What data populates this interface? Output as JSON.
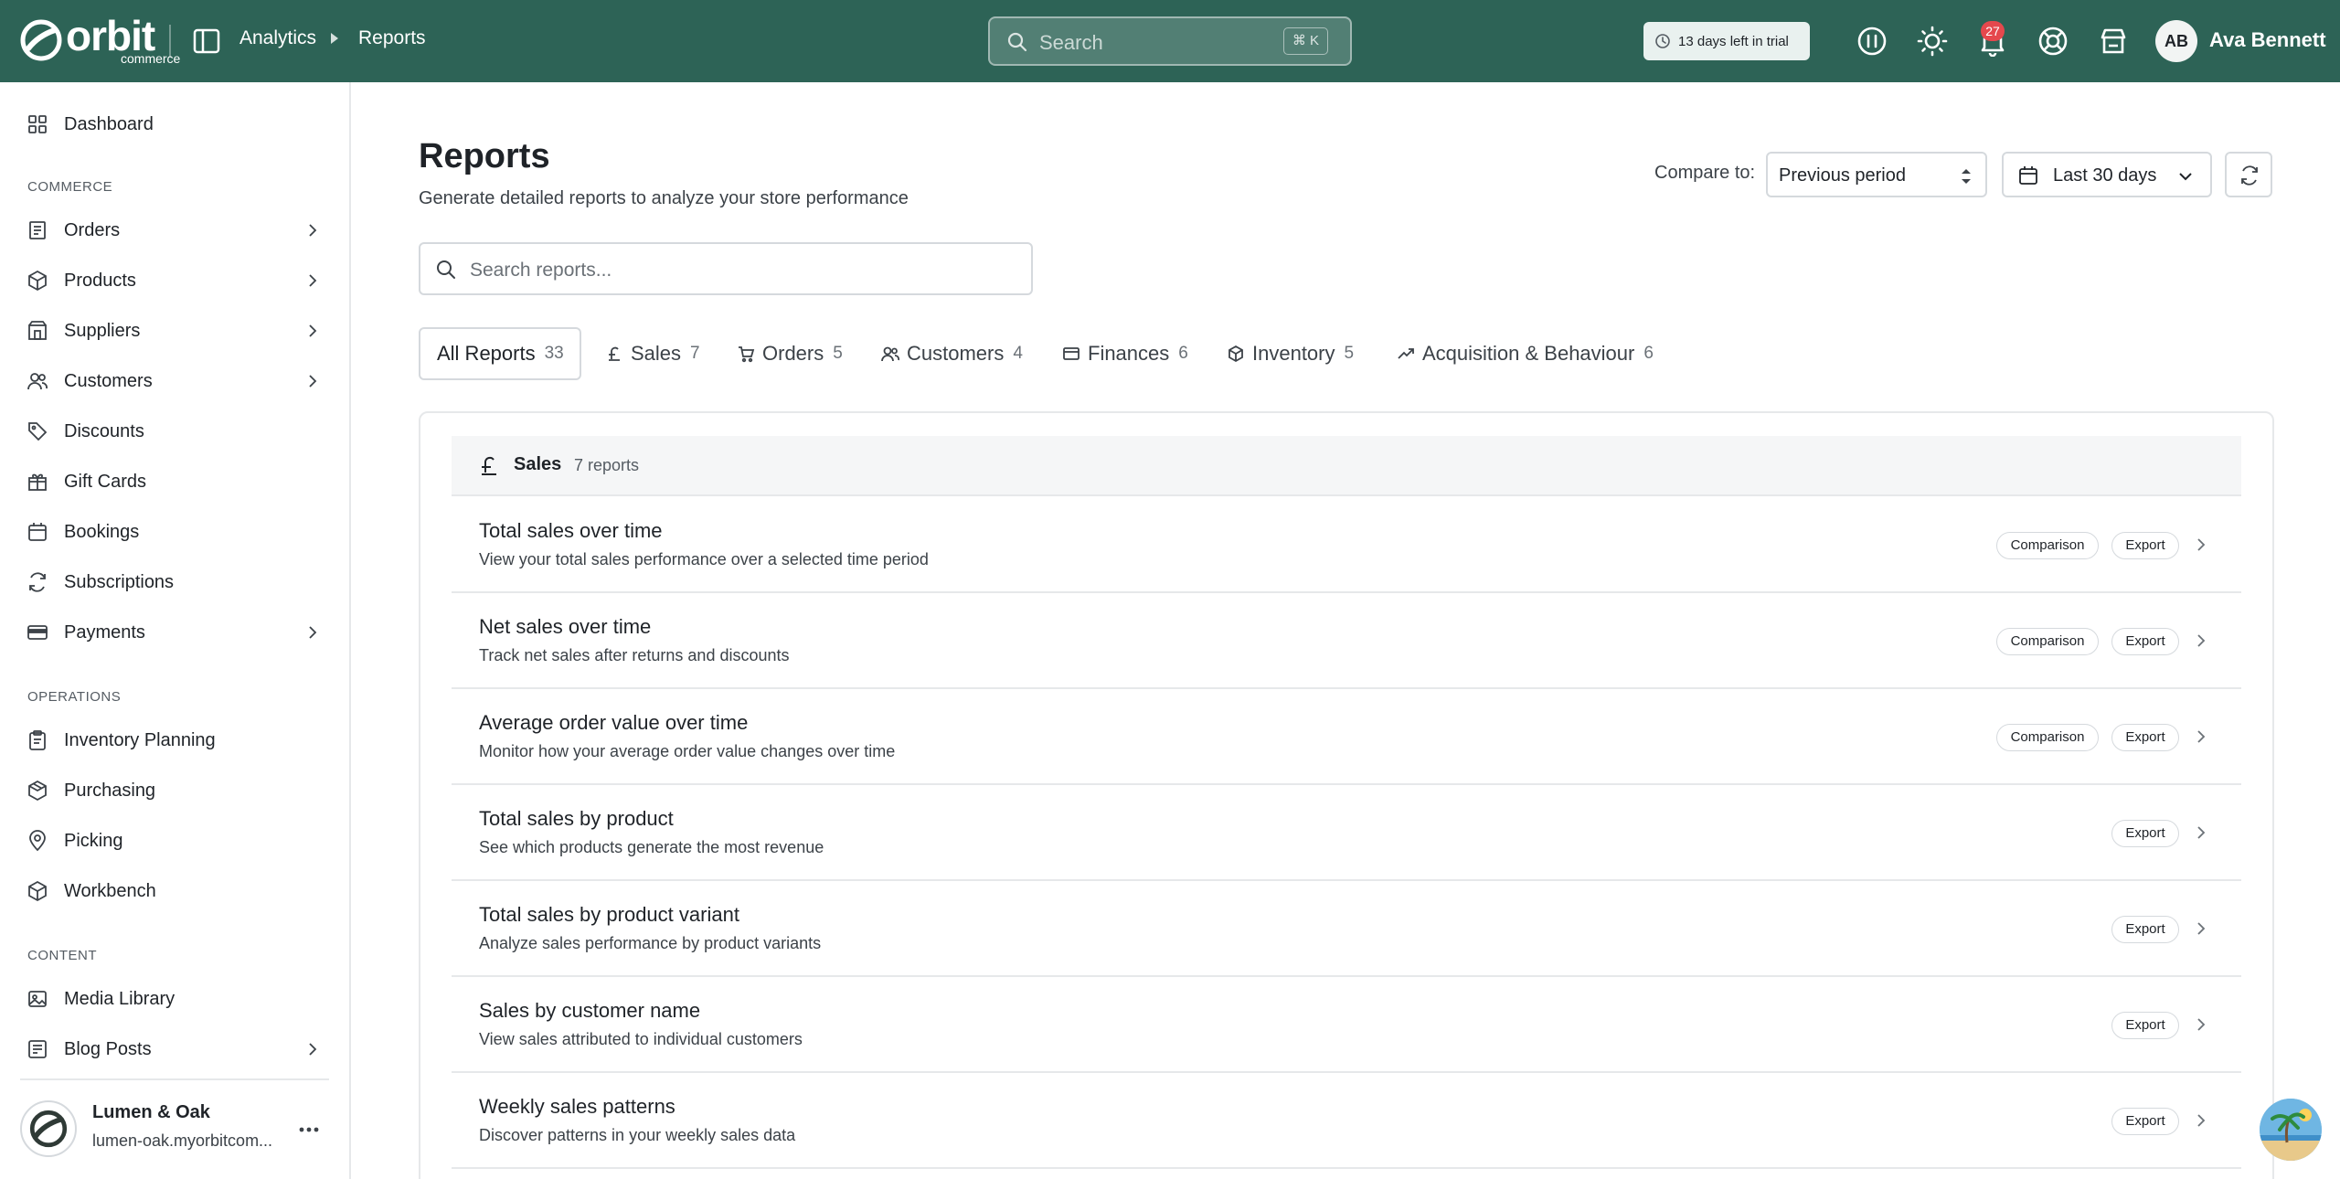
{
  "brand": {
    "name": "orbit",
    "sub": "commerce"
  },
  "breadcrumb": [
    "Analytics",
    "Reports"
  ],
  "search": {
    "placeholder": "Search",
    "shortcut": "⌘ K"
  },
  "trial": {
    "text": "13 days left in trial"
  },
  "notifications": {
    "count": "27"
  },
  "user": {
    "initials": "AB",
    "name": "Ava Bennett"
  },
  "sidebar": {
    "items": [
      {
        "label": "Dashboard",
        "icon": "dashboard-icon"
      },
      {
        "label": "Orders",
        "icon": "orders-icon",
        "expandable": true
      },
      {
        "label": "Products",
        "icon": "products-icon",
        "expandable": true
      },
      {
        "label": "Suppliers",
        "icon": "suppliers-icon",
        "expandable": true
      },
      {
        "label": "Customers",
        "icon": "customers-icon",
        "expandable": true
      },
      {
        "label": "Discounts",
        "icon": "tag-icon"
      },
      {
        "label": "Gift Cards",
        "icon": "gift-icon"
      },
      {
        "label": "Bookings",
        "icon": "calendar-icon"
      },
      {
        "label": "Subscriptions",
        "icon": "refresh-icon"
      },
      {
        "label": "Payments",
        "icon": "card-icon",
        "expandable": true
      },
      {
        "label": "Inventory Planning",
        "icon": "clipboard-icon"
      },
      {
        "label": "Purchasing",
        "icon": "purchasing-icon"
      },
      {
        "label": "Picking",
        "icon": "location-pin-icon"
      },
      {
        "label": "Workbench",
        "icon": "workbench-icon"
      },
      {
        "label": "Media Library",
        "icon": "image-icon"
      },
      {
        "label": "Blog Posts",
        "icon": "blog-icon",
        "expandable": true
      }
    ],
    "sections": [
      "COMMERCE",
      "OPERATIONS",
      "CONTENT"
    ],
    "store": {
      "name": "Lumen & Oak",
      "url": "lumen-oak.myorbitcom..."
    }
  },
  "page": {
    "title": "Reports",
    "subtitle": "Generate detailed reports to analyze your store performance",
    "compare_label": "Compare to:",
    "compare_value": "Previous period",
    "date_range": "Last 30 days",
    "search_placeholder": "Search reports..."
  },
  "tabs": [
    {
      "label": "All Reports",
      "count": "33"
    },
    {
      "label": "Sales",
      "count": "7"
    },
    {
      "label": "Orders",
      "count": "5"
    },
    {
      "label": "Customers",
      "count": "4"
    },
    {
      "label": "Finances",
      "count": "6"
    },
    {
      "label": "Inventory",
      "count": "5"
    },
    {
      "label": "Acquisition & Behaviour",
      "count": "6"
    }
  ],
  "group": {
    "title": "Sales",
    "count": "7 reports"
  },
  "reports": [
    {
      "title": "Total sales over time",
      "desc": "View your total sales performance over a selected time period",
      "comparison": "Comparison",
      "export": "Export"
    },
    {
      "title": "Net sales over time",
      "desc": "Track net sales after returns and discounts",
      "comparison": "Comparison",
      "export": "Export"
    },
    {
      "title": "Average order value over time",
      "desc": "Monitor how your average order value changes over time",
      "comparison": "Comparison",
      "export": "Export"
    },
    {
      "title": "Total sales by product",
      "desc": "See which products generate the most revenue",
      "export": "Export"
    },
    {
      "title": "Total sales by product variant",
      "desc": "Analyze sales performance by product variants",
      "export": "Export"
    },
    {
      "title": "Sales by customer name",
      "desc": "View sales attributed to individual customers",
      "export": "Export"
    },
    {
      "title": "Weekly sales patterns",
      "desc": "Discover patterns in your weekly sales data",
      "export": "Export"
    }
  ],
  "colors": {
    "topbar": "#2d6356",
    "badge": "#e5484d"
  }
}
